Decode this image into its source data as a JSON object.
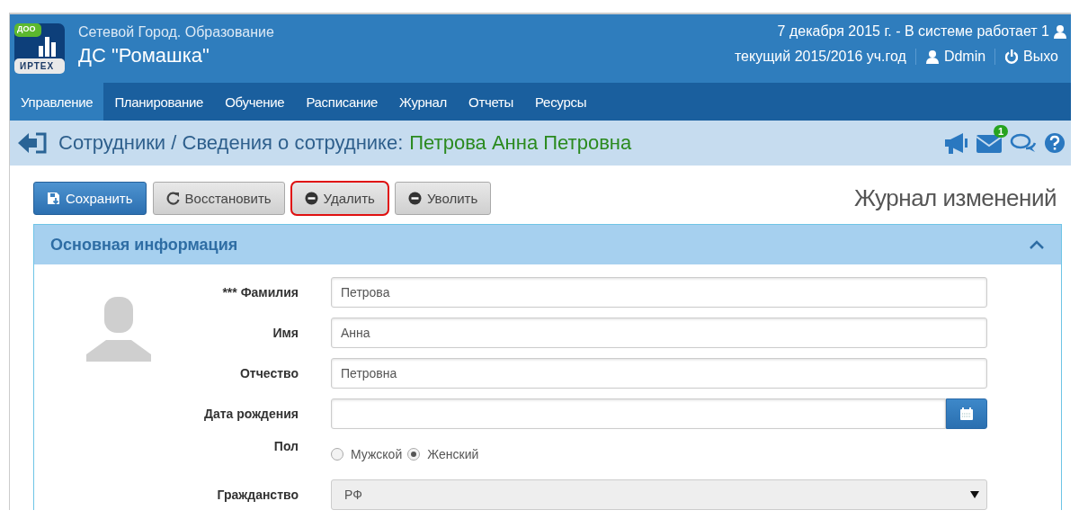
{
  "header": {
    "app_name": "Сетевой Город. Образование",
    "org_name": "ДС \"Ромашка\"",
    "logo": {
      "badge": "ДОО",
      "brand": "ИРТЕХ"
    },
    "status": "7 декабря 2015 г. - В системе работает 1",
    "year": "текущий 2015/2016 уч.год",
    "user": "Ddmin",
    "logout": "Выхо"
  },
  "nav": [
    {
      "label": "Управление",
      "selected": true
    },
    {
      "label": "Планирование",
      "selected": false
    },
    {
      "label": "Обучение",
      "selected": false
    },
    {
      "label": "Расписание",
      "selected": false
    },
    {
      "label": "Журнал",
      "selected": false
    },
    {
      "label": "Отчеты",
      "selected": false
    },
    {
      "label": "Ресурсы",
      "selected": false
    }
  ],
  "breadcrumb": {
    "path": "Сотрудники / Сведения о сотруднике:",
    "name": "Петрова Анна Петровна",
    "mail_badge": "1"
  },
  "toolbar": {
    "buttons": [
      {
        "kind": "save",
        "label": "Сохранить",
        "highlighted": false
      },
      {
        "kind": "restore",
        "label": "Восстановить",
        "highlighted": false
      },
      {
        "kind": "remove",
        "label": "Удалить",
        "highlighted": true
      },
      {
        "kind": "remove",
        "label": "Уволить",
        "highlighted": false
      }
    ],
    "log_link": "Журнал изменений"
  },
  "panel": {
    "title": "Основная информация",
    "expanded": true,
    "fields": [
      {
        "kind": "text",
        "label": "*** Фамилия",
        "value": "Петрова"
      },
      {
        "kind": "text",
        "label": "Имя",
        "value": "Анна"
      },
      {
        "kind": "text",
        "label": "Отчество",
        "value": "Петровна"
      },
      {
        "kind": "date",
        "label": "Дата рождения"
      },
      {
        "kind": "radio",
        "label": "Пол",
        "options": [
          {
            "label": "Мужской",
            "selected": false
          },
          {
            "label": "Женский",
            "selected": true
          }
        ]
      },
      {
        "kind": "select",
        "label": "Гражданство",
        "value": "РФ"
      }
    ]
  }
}
